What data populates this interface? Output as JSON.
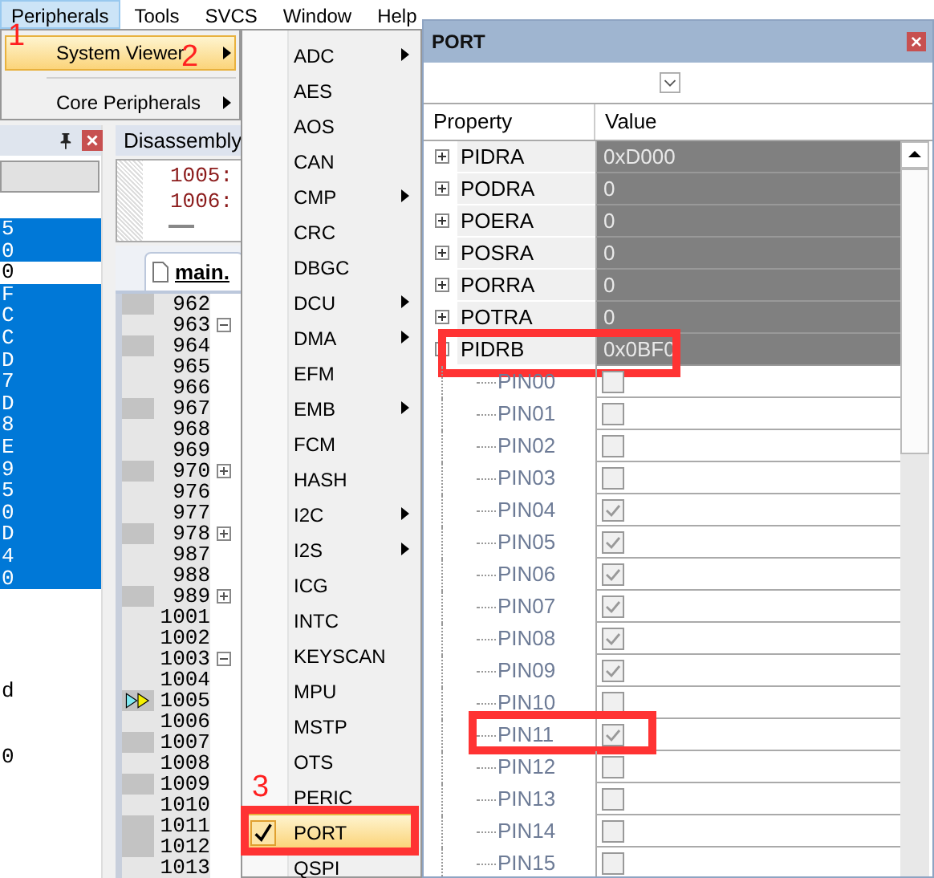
{
  "menu_bar": [
    {
      "label": "Peripherals",
      "selected": true,
      "callout": "1"
    },
    {
      "label": "Tools",
      "selected": false
    },
    {
      "label": "SVCS",
      "selected": false
    },
    {
      "label": "Window",
      "selected": false
    },
    {
      "label": "Help",
      "selected": false
    }
  ],
  "peripherals_menu": [
    {
      "label": "System Viewer",
      "selected": true,
      "submenu": true,
      "callout": "2"
    },
    {
      "label": "Core Peripherals",
      "selected": false,
      "submenu": true
    }
  ],
  "system_viewer_menu": [
    {
      "label": "ADC",
      "submenu": true,
      "checked": false,
      "selected": false
    },
    {
      "label": "AES",
      "submenu": false,
      "checked": false,
      "selected": false
    },
    {
      "label": "AOS",
      "submenu": false,
      "checked": false,
      "selected": false
    },
    {
      "label": "CAN",
      "submenu": false,
      "checked": false,
      "selected": false
    },
    {
      "label": "CMP",
      "submenu": true,
      "checked": false,
      "selected": false
    },
    {
      "label": "CRC",
      "submenu": false,
      "checked": false,
      "selected": false
    },
    {
      "label": "DBGC",
      "submenu": false,
      "checked": false,
      "selected": false
    },
    {
      "label": "DCU",
      "submenu": true,
      "checked": false,
      "selected": false
    },
    {
      "label": "DMA",
      "submenu": true,
      "checked": false,
      "selected": false
    },
    {
      "label": "EFM",
      "submenu": false,
      "checked": false,
      "selected": false
    },
    {
      "label": "EMB",
      "submenu": true,
      "checked": false,
      "selected": false
    },
    {
      "label": "FCM",
      "submenu": false,
      "checked": false,
      "selected": false
    },
    {
      "label": "HASH",
      "submenu": false,
      "checked": false,
      "selected": false
    },
    {
      "label": "I2C",
      "submenu": true,
      "checked": false,
      "selected": false
    },
    {
      "label": "I2S",
      "submenu": true,
      "checked": false,
      "selected": false
    },
    {
      "label": "ICG",
      "submenu": false,
      "checked": false,
      "selected": false
    },
    {
      "label": "INTC",
      "submenu": false,
      "checked": false,
      "selected": false
    },
    {
      "label": "KEYSCAN",
      "submenu": false,
      "checked": false,
      "selected": false
    },
    {
      "label": "MPU",
      "submenu": false,
      "checked": false,
      "selected": false
    },
    {
      "label": "MSTP",
      "submenu": false,
      "checked": false,
      "selected": false
    },
    {
      "label": "OTS",
      "submenu": false,
      "checked": false,
      "selected": false
    },
    {
      "label": "PERIC",
      "submenu": false,
      "checked": false,
      "selected": false
    },
    {
      "label": "PORT",
      "submenu": false,
      "checked": true,
      "selected": true,
      "boxed": true,
      "callout": "3"
    },
    {
      "label": "QSPI",
      "submenu": false,
      "checked": false,
      "selected": false
    }
  ],
  "left_panel": {
    "values": [
      {
        "text": "5",
        "selected": true
      },
      {
        "text": "0",
        "selected": true
      },
      {
        "text": "0",
        "selected": false
      },
      {
        "text": "F",
        "selected": true
      },
      {
        "text": "C",
        "selected": true
      },
      {
        "text": "C",
        "selected": true
      },
      {
        "text": "D",
        "selected": true
      },
      {
        "text": "7",
        "selected": true
      },
      {
        "text": "D",
        "selected": true
      },
      {
        "text": "8",
        "selected": true
      },
      {
        "text": "E",
        "selected": true
      },
      {
        "text": "9",
        "selected": true
      },
      {
        "text": "5",
        "selected": true
      },
      {
        "text": "0",
        "selected": true
      },
      {
        "text": "D",
        "selected": true
      },
      {
        "text": "4",
        "selected": true
      },
      {
        "text": "0",
        "selected": true
      }
    ],
    "lower_values": [
      "d",
      "0"
    ]
  },
  "disassembly": {
    "title": "Disassembly",
    "lines": [
      "1005:",
      "1006:"
    ]
  },
  "editor": {
    "tab": "main.",
    "lines": [
      {
        "number": "962",
        "executable": true
      },
      {
        "number": "963",
        "executable": false,
        "fold_expanded": true
      },
      {
        "number": "964",
        "executable": true
      },
      {
        "number": "965",
        "executable": false
      },
      {
        "number": "966",
        "executable": false
      },
      {
        "number": "967",
        "executable": true
      },
      {
        "number": "968",
        "executable": false
      },
      {
        "number": "969",
        "executable": false
      },
      {
        "number": "970",
        "executable": true,
        "fold_expanded": false
      },
      {
        "number": "976",
        "executable": false
      },
      {
        "number": "977",
        "executable": false
      },
      {
        "number": "978",
        "executable": true,
        "fold_expanded": false
      },
      {
        "number": "987",
        "executable": false
      },
      {
        "number": "988",
        "executable": false
      },
      {
        "number": "989",
        "executable": true,
        "fold_expanded": false
      },
      {
        "number": "1001",
        "executable": false
      },
      {
        "number": "1002",
        "executable": false
      },
      {
        "number": "1003",
        "executable": false,
        "fold_expanded": true
      },
      {
        "number": "1004",
        "executable": false
      },
      {
        "number": "1005",
        "executable": true,
        "current": true
      },
      {
        "number": "1006",
        "executable": false
      },
      {
        "number": "1007",
        "executable": true
      },
      {
        "number": "1008",
        "executable": false
      },
      {
        "number": "1009",
        "executable": true
      },
      {
        "number": "1010",
        "executable": false
      },
      {
        "number": "1011",
        "executable": true
      },
      {
        "number": "1012",
        "executable": true
      },
      {
        "number": "1013",
        "executable": false
      }
    ]
  },
  "port_window": {
    "title": "PORT",
    "columns": [
      "Property",
      "Value"
    ],
    "registers": [
      {
        "name": "PIDRA",
        "value": "0xD000",
        "expanded": false
      },
      {
        "name": "PODRA",
        "value": "0",
        "expanded": false
      },
      {
        "name": "POERA",
        "value": "0",
        "expanded": false
      },
      {
        "name": "POSRA",
        "value": "0",
        "expanded": false
      },
      {
        "name": "PORRA",
        "value": "0",
        "expanded": false
      },
      {
        "name": "POTRA",
        "value": "0",
        "expanded": false
      },
      {
        "name": "PIDRB",
        "value": "0x0BF0",
        "expanded": true,
        "boxed": true,
        "children": [
          {
            "name": "PIN00",
            "checked": false
          },
          {
            "name": "PIN01",
            "checked": false
          },
          {
            "name": "PIN02",
            "checked": false
          },
          {
            "name": "PIN03",
            "checked": false
          },
          {
            "name": "PIN04",
            "checked": true
          },
          {
            "name": "PIN05",
            "checked": true
          },
          {
            "name": "PIN06",
            "checked": true
          },
          {
            "name": "PIN07",
            "checked": true
          },
          {
            "name": "PIN08",
            "checked": true
          },
          {
            "name": "PIN09",
            "checked": true
          },
          {
            "name": "PIN10",
            "checked": false
          },
          {
            "name": "PIN11",
            "checked": true,
            "boxed": true
          },
          {
            "name": "PIN12",
            "checked": false
          },
          {
            "name": "PIN13",
            "checked": false
          },
          {
            "name": "PIN14",
            "checked": false
          },
          {
            "name": "PIN15",
            "checked": false
          }
        ]
      }
    ]
  }
}
